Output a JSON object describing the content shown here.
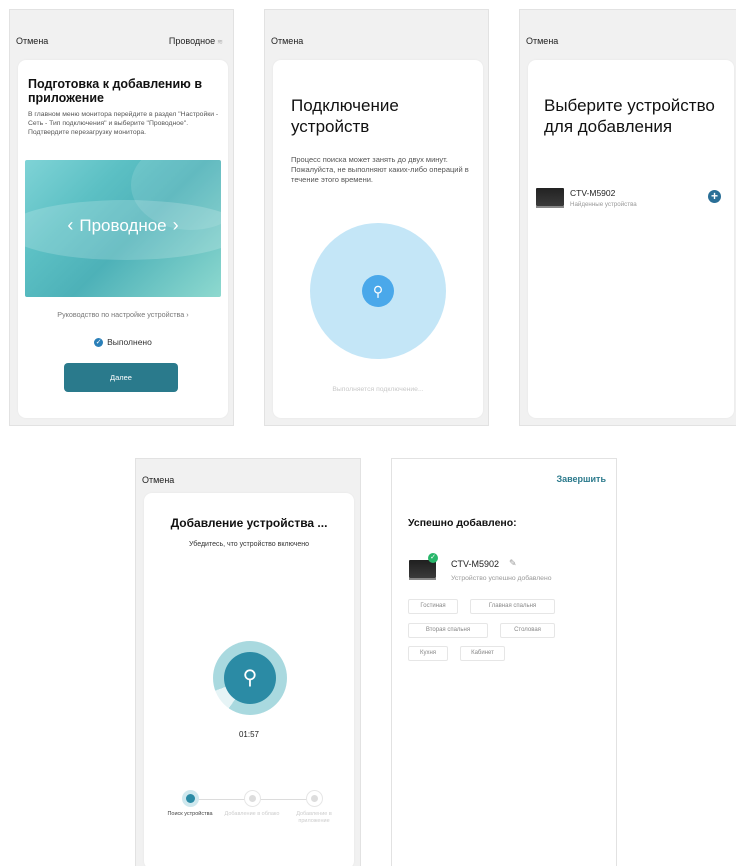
{
  "screen1": {
    "cancel": "Отмена",
    "network": "Проводное",
    "network_icon": "wifi-icon",
    "title": "Подготовка к добавлению в приложение",
    "description": "В главном меню монитора перейдите в раздел \"Настройки - Сеть - Тип подключения\" и выберите \"Проводное\". Подтвердите перезагрузку монитора.",
    "banner_label": "Проводное",
    "guide_link": "Руководство по настройке устройства",
    "done_label": "Выполнено",
    "next_button": "Далее"
  },
  "screen2": {
    "cancel": "Отмена",
    "title": "Подключение устройств",
    "description": "Процесс поиска может занять до двух минут. Пожалуйста, не выполняют каких-либо операций в течение этого времени.",
    "status": "Выполняется подключение..."
  },
  "screen3": {
    "cancel": "Отмена",
    "title": "Выберите устройство для добавления",
    "device_name": "CTV-M5902",
    "device_sub": "Найденные устройства"
  },
  "screen4": {
    "cancel": "Отмена",
    "title": "Добавление устройства ...",
    "subtitle": "Убедитесь, что устройство включено",
    "timer": "01:57",
    "progress_arc_fraction": 0.9,
    "steps": [
      {
        "label": "Поиск устройства",
        "active": true
      },
      {
        "label": "Добавление в облако",
        "active": false
      },
      {
        "label": "Добавление в приложение",
        "active": false
      }
    ]
  },
  "screen5": {
    "finish": "Завершить",
    "title": "Успешно добавлено:",
    "device_name": "CTV-M5902",
    "device_sub": "Устройство успешно добавлено",
    "rooms": [
      "Гостиная",
      "Главная спальня",
      "Вторая спальня",
      "Столовая",
      "Кухня",
      "Кабинет"
    ]
  }
}
